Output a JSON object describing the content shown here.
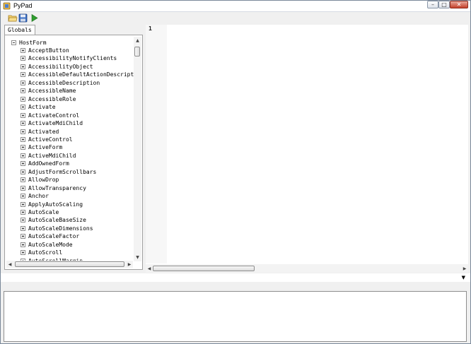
{
  "window": {
    "title": "PyPad",
    "controls": {
      "minimize": "–",
      "maximize": "□",
      "close": "✕"
    }
  },
  "toolbar": {
    "buttons": [
      {
        "name": "open-icon"
      },
      {
        "name": "save-icon"
      },
      {
        "name": "run-icon"
      }
    ]
  },
  "sidebar": {
    "tab_label": "Globals",
    "root": "HostForm",
    "items": [
      "AcceptButton",
      "AccessibilityNotifyClients",
      "AccessibilityObject",
      "AccessibleDefaultActionDescription",
      "AccessibleDescription",
      "AccessibleName",
      "AccessibleRole",
      "Activate",
      "ActivateControl",
      "ActivateMdiChild",
      "Activated",
      "ActiveControl",
      "ActiveForm",
      "ActiveMdiChild",
      "AddOwnedForm",
      "AdjustFormScrollbars",
      "AllowDrop",
      "AllowTransparency",
      "Anchor",
      "ApplyAutoScaling",
      "AutoScale",
      "AutoScaleBaseSize",
      "AutoScaleDimensions",
      "AutoScaleFactor",
      "AutoScaleMode",
      "AutoScroll",
      "AutoScrollMargin"
    ]
  },
  "editor": {
    "line_number": "1"
  },
  "colors": {
    "accent_close": "#c4412c",
    "run_green": "#2f9e2f",
    "border": "#a0a0a0"
  }
}
